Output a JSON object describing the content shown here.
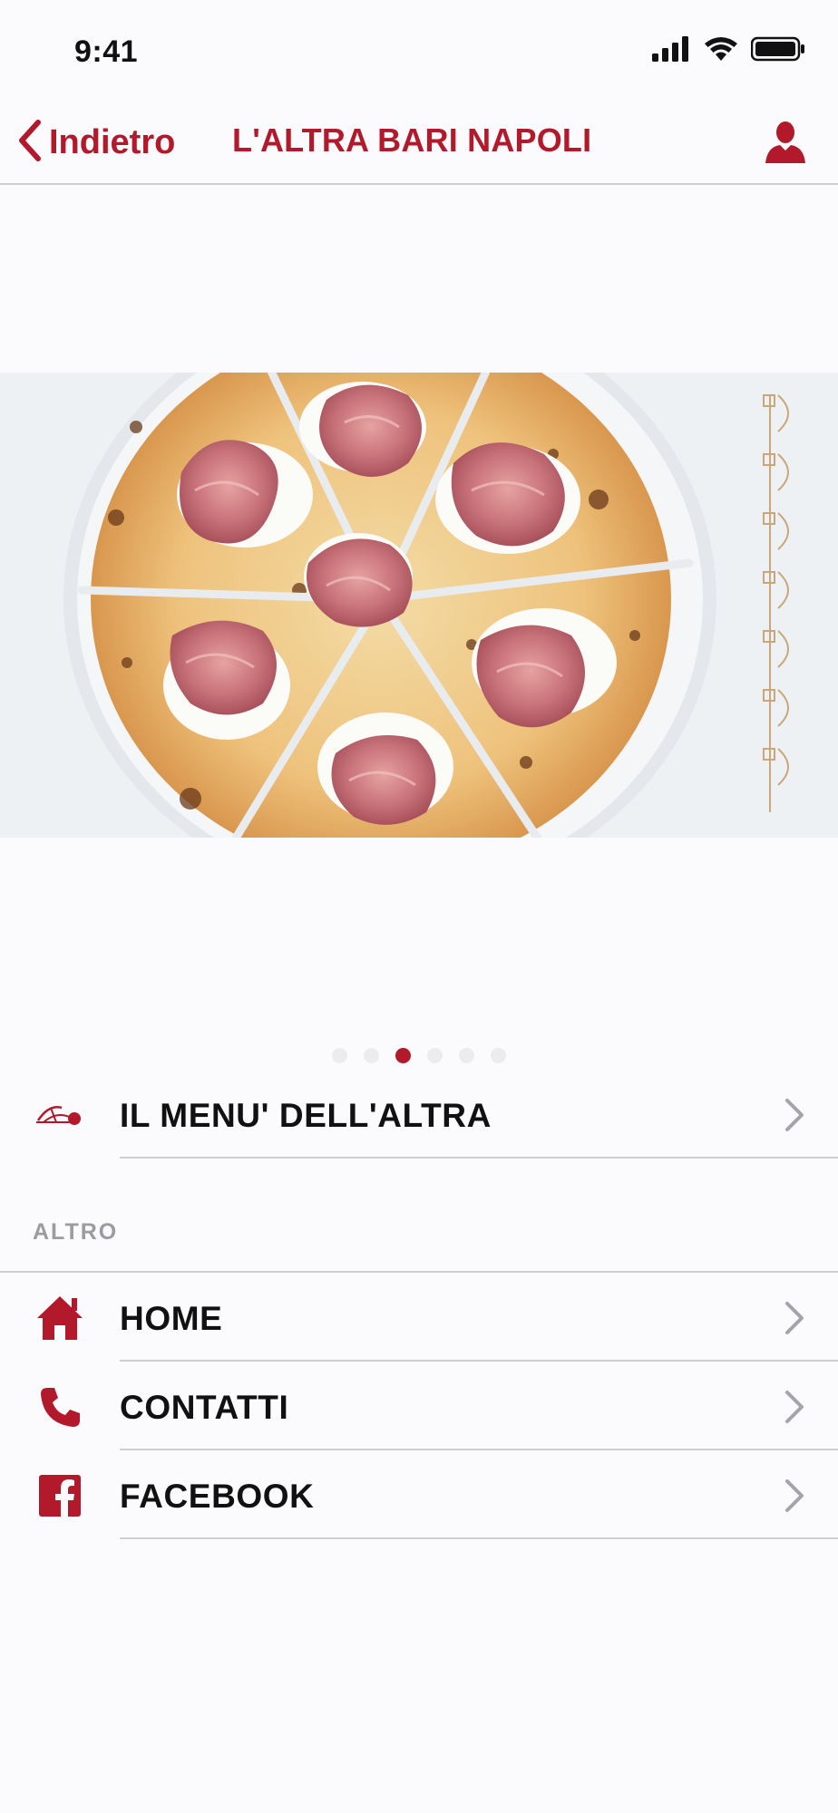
{
  "status_bar": {
    "time": "9:41",
    "icons": [
      "signal-icon",
      "wifi-icon",
      "battery-icon"
    ]
  },
  "nav": {
    "back_label": "Indietro",
    "title": "L'ALTRA BARI NAPOLI",
    "profile_icon": "user-icon"
  },
  "hero": {
    "image": "pizza-with-prosciutto",
    "page_count": 6,
    "active_page": 3
  },
  "menu_row": {
    "label": "IL MENU' DELL'ALTRA",
    "icon": "restaurant-logo-icon"
  },
  "section": {
    "title": "ALTRO"
  },
  "links": [
    {
      "label": "HOME",
      "icon": "home-icon"
    },
    {
      "label": "CONTATTI",
      "icon": "phone-icon"
    },
    {
      "label": "FACEBOOK",
      "icon": "facebook-icon"
    }
  ],
  "colors": {
    "accent": "#b21a2b",
    "text": "#111111",
    "section_header": "#9b9ba0",
    "divider": "#cfcfd3"
  }
}
